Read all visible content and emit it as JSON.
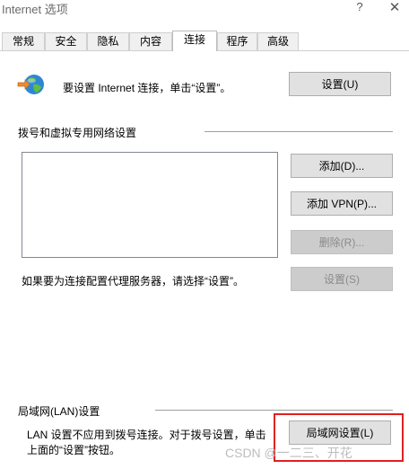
{
  "window": {
    "title": "Internet 选项",
    "help_glyph": "?",
    "close_glyph": "✕"
  },
  "tabs": [
    {
      "label": "常规"
    },
    {
      "label": "安全"
    },
    {
      "label": "隐私"
    },
    {
      "label": "内容"
    },
    {
      "label": "连接"
    },
    {
      "label": "程序"
    },
    {
      "label": "高级"
    }
  ],
  "active_tab": "连接",
  "setup": {
    "text": "要设置 Internet 连接，单击“设置”。",
    "button": "设置(U)"
  },
  "dialup": {
    "title": "拨号和虚拟专用网络设置",
    "buttons": {
      "add": "添加(D)...",
      "add_vpn": "添加 VPN(P)...",
      "remove": "删除(R)...",
      "settings": "设置(S)"
    },
    "proxy_text": "如果要为连接配置代理服务器，请选择“设置”。"
  },
  "lan": {
    "title": "局域网(LAN)设置",
    "text": "LAN 设置不应用到拨号连接。对于拨号设置，单击上面的“设置”按钮。",
    "button": "局域网设置(L)"
  },
  "watermark": "CSDN @一二三、开花",
  "colors": {
    "highlight": "#e02020",
    "button_bg": "#e1e1e1",
    "disabled_bg": "#cccccc"
  }
}
